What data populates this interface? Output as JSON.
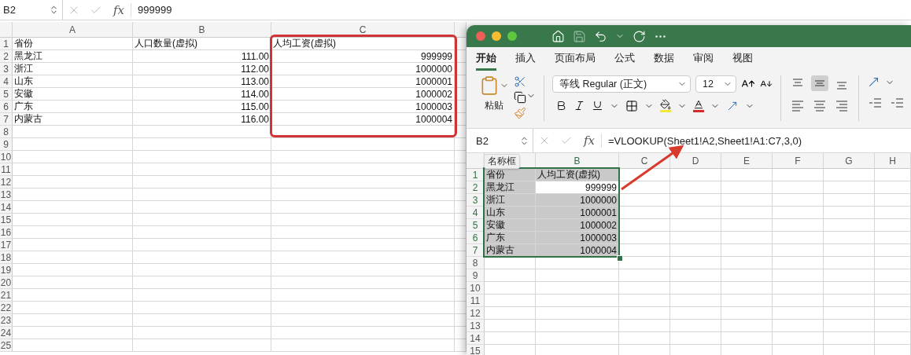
{
  "sheet": {
    "name_box": "B2",
    "function_label": "fx",
    "formula": "999999",
    "columns": [
      "A",
      "B",
      "C"
    ],
    "rows": [
      {
        "number": "1",
        "cells": [
          "省份",
          "人口数量(虚拟)",
          "人均工资(虚拟)"
        ]
      },
      {
        "number": "2",
        "cells": [
          "黑龙江",
          "111.00",
          "999999"
        ]
      },
      {
        "number": "3",
        "cells": [
          "浙江",
          "112.00",
          "1000000"
        ]
      },
      {
        "number": "4",
        "cells": [
          "山东",
          "113.00",
          "1000001"
        ]
      },
      {
        "number": "5",
        "cells": [
          "安徽",
          "114.00",
          "1000002"
        ]
      },
      {
        "number": "6",
        "cells": [
          "广东",
          "115.00",
          "1000003"
        ]
      },
      {
        "number": "7",
        "cells": [
          "内蒙古",
          "116.00",
          "1000004"
        ]
      }
    ],
    "empty_rows": [
      "8",
      "9",
      "10",
      "11",
      "12",
      "13",
      "14",
      "15",
      "16",
      "17",
      "18",
      "19",
      "20",
      "21",
      "22",
      "23",
      "24",
      "25"
    ]
  },
  "window": {
    "tabs": [
      {
        "label": "开始",
        "selected": true
      },
      {
        "label": "插入",
        "selected": false
      },
      {
        "label": "页面布局",
        "selected": false
      },
      {
        "label": "公式",
        "selected": false
      },
      {
        "label": "数据",
        "selected": false
      },
      {
        "label": "审阅",
        "selected": false
      },
      {
        "label": "视图",
        "selected": false
      }
    ],
    "ribbon": {
      "paste_label": "粘贴",
      "font_name": "等线 Regular (正文)",
      "font_size": "12"
    },
    "name_box": "B2",
    "function_label": "fx",
    "formula": "=VLOOKUP(Sheet1!A2,Sheet1!A1:C7,3,0)",
    "tooltip": "名称框",
    "columns": [
      "B",
      "C",
      "D",
      "E",
      "F",
      "G",
      "H"
    ],
    "rows": [
      {
        "number": "1",
        "cells": [
          {
            "text": "省份",
            "selected": true
          },
          {
            "text": "人均工资(虚拟)",
            "selected": true
          }
        ]
      },
      {
        "number": "2",
        "cells": [
          {
            "text": "黑龙江",
            "selected": true
          },
          {
            "text": "999999",
            "selected": false
          }
        ]
      },
      {
        "number": "3",
        "cells": [
          {
            "text": "浙江",
            "selected": true
          },
          {
            "text": "1000000",
            "selected": true
          }
        ]
      },
      {
        "number": "4",
        "cells": [
          {
            "text": "山东",
            "selected": true
          },
          {
            "text": "1000001",
            "selected": true
          }
        ]
      },
      {
        "number": "5",
        "cells": [
          {
            "text": "安徽",
            "selected": true
          },
          {
            "text": "1000002",
            "selected": true
          }
        ]
      },
      {
        "number": "6",
        "cells": [
          {
            "text": "广东",
            "selected": true
          },
          {
            "text": "1000003",
            "selected": true
          }
        ]
      },
      {
        "number": "7",
        "cells": [
          {
            "text": "内蒙古",
            "selected": true
          },
          {
            "text": "1000004",
            "selected": true
          }
        ]
      }
    ],
    "empty_rows": [
      "8",
      "9",
      "10",
      "11",
      "12",
      "13",
      "14",
      "15"
    ]
  }
}
